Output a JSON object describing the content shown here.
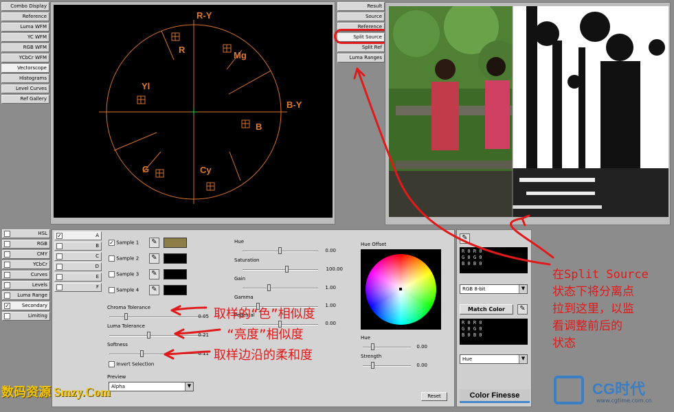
{
  "left_tabs": [
    "Combo Display",
    "Reference",
    "Luma WFM",
    "YC WFM",
    "RGB WFM",
    "YCbCr WFM",
    "Vectorscope",
    "Histograms",
    "Level Curves",
    "Ref Gallery"
  ],
  "vectorscope": {
    "axis_labels": {
      "ry": "R-Y",
      "by": "B-Y"
    },
    "targets": {
      "r": "R",
      "mg": "Mg",
      "yl": "Yl",
      "b": "B",
      "g": "G",
      "cy": "Cy"
    }
  },
  "view_tabs": [
    "Result",
    "Source",
    "Reference",
    "Split Source",
    "Split Ref",
    "Luma Ranges"
  ],
  "mode_tabs": [
    "HSL",
    "RGB",
    "CMY",
    "YCbCr",
    "Curves",
    "Levels",
    "Luma Range",
    "Secondary",
    "Limiting"
  ],
  "layers": [
    "A",
    "B",
    "C",
    "D",
    "E",
    "F"
  ],
  "samples": [
    {
      "label": "Sample 1",
      "checked": true,
      "color": "#8b7d45"
    },
    {
      "label": "Sample 2",
      "checked": false,
      "color": "#000000"
    },
    {
      "label": "Sample 3",
      "checked": false,
      "color": "#000000"
    },
    {
      "label": "Sample 4",
      "checked": false,
      "color": "#000000"
    }
  ],
  "tolerances": {
    "chroma": {
      "label": "Chroma Tolerance",
      "value": "0.05"
    },
    "luma": {
      "label": "Luma Tolerance",
      "value": "0.21"
    },
    "softness": {
      "label": "Softness",
      "value": "0.11"
    },
    "invert": "Invert Selection"
  },
  "preview": {
    "label": "Preview",
    "value": "Alpha"
  },
  "adjust": {
    "hue": {
      "label": "Hue",
      "value": "0.00"
    },
    "saturation": {
      "label": "Saturation",
      "value": "100.00"
    },
    "gain": {
      "label": "Gain",
      "value": "1.00"
    },
    "gamma": {
      "label": "Gamma",
      "value": "1.00"
    },
    "pedestal": {
      "label": "Pedestal",
      "value": "0.00"
    }
  },
  "hue_offset": {
    "title": "Hue Offset",
    "hue": {
      "label": "Hue",
      "value": "0.00"
    },
    "strength": {
      "label": "Strength",
      "value": "0.00"
    }
  },
  "reset_label": "Reset",
  "readout_top": [
    "R    0 R    0",
    "G    0 G    0",
    "B    0 B    0"
  ],
  "rgb_format": "RGB 8-bit",
  "match_color": "Match Color",
  "readout_bottom": [
    "R    0 R    0",
    "G    0 G    0",
    "B    0 B    0"
  ],
  "match_mode": "Hue",
  "brand": "Color Finesse",
  "annotations": {
    "color_similarity": "取样的“色”相似度",
    "luma_similarity": "“亮度”相似度",
    "edge_softness": "取样边沿的柔和度",
    "split_note": [
      "在Split Source",
      "状态下将分离点",
      "拉到这里，以监",
      "看调整前后的",
      "状态"
    ]
  },
  "watermark_left": "数码资源 Smzy.Com",
  "watermark_right": {
    "logo": "CG时代",
    "url": "www.cgtime.com.cn"
  }
}
